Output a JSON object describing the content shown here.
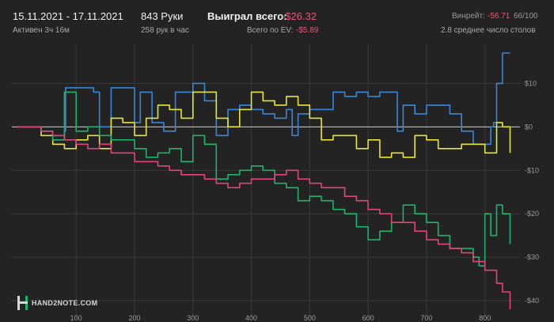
{
  "header": {
    "date_range": "15.11.2021 - 17.11.2021",
    "active": "Активен 3ч 16м",
    "hands": "843 Руки",
    "hands_per_hour": "258 рук в час",
    "won_label": "Выиграл всего:",
    "won_value": "-$26.32",
    "ev_label": "Всего по EV:",
    "ev_value": "-$5.89",
    "winrate_label": "Винрейт:",
    "winrate_value": "-56.71",
    "winrate_hands": "66/100",
    "avg_tables": "2.8 среднее число столов"
  },
  "logo": {
    "text": "HAND2NOTE.COM"
  },
  "chart_data": {
    "type": "line",
    "xlim": [
      -10,
      860
    ],
    "ylim": [
      -44,
      19
    ],
    "xticks": [
      100,
      200,
      300,
      400,
      500,
      600,
      700,
      800
    ],
    "yticks": [
      10,
      0,
      -10,
      -20,
      -30,
      -40
    ],
    "ytick_labels": [
      "$10",
      "$0",
      "-$10",
      "-$20",
      "-$30",
      "-$40"
    ],
    "grid": true,
    "colors": {
      "blue": "#3a86d8",
      "yellow": "#e6e63a",
      "green": "#1fb36b",
      "pink": "#e0457a",
      "zero": "#cfcfcf"
    },
    "series": [
      {
        "color": "#3a86d8",
        "x": [
          0,
          40,
          60,
          80,
          82,
          100,
          130,
          140,
          160,
          180,
          200,
          210,
          230,
          250,
          270,
          290,
          300,
          320,
          340,
          360,
          380,
          400,
          420,
          440,
          460,
          470,
          480,
          500,
          520,
          540,
          560,
          580,
          600,
          620,
          640,
          650,
          660,
          680,
          700,
          720,
          740,
          760,
          780,
          800,
          810,
          815,
          820,
          830,
          843
        ],
        "y": [
          0,
          -1,
          -2,
          -1,
          9,
          9,
          8,
          0,
          9,
          9,
          1,
          8,
          1,
          -1,
          8,
          8,
          10,
          6,
          -2,
          4,
          5,
          4,
          3,
          2,
          4,
          -2,
          3,
          4,
          4,
          8,
          7,
          8,
          7,
          8,
          8,
          -1,
          5,
          3,
          5,
          5,
          3,
          -1,
          -4,
          -4,
          0,
          1,
          10,
          17,
          17
        ]
      },
      {
        "color": "#e6e63a",
        "x": [
          0,
          40,
          60,
          80,
          100,
          120,
          140,
          160,
          180,
          200,
          220,
          240,
          260,
          280,
          300,
          320,
          340,
          360,
          380,
          400,
          420,
          440,
          460,
          480,
          500,
          520,
          540,
          560,
          580,
          600,
          620,
          640,
          660,
          680,
          700,
          720,
          740,
          760,
          780,
          800,
          820,
          830,
          843
        ],
        "y": [
          0,
          -2,
          -4,
          -5,
          -3,
          -2,
          -5,
          2,
          1,
          -2,
          2,
          5,
          4,
          2,
          8,
          8,
          2,
          0,
          4,
          8,
          6,
          5,
          7,
          5,
          2,
          -3,
          -2,
          -2,
          -5,
          -3,
          -7,
          -6,
          -7,
          -2,
          -3,
          -5,
          -5,
          -4,
          -4,
          -6,
          1,
          0,
          -6
        ]
      },
      {
        "color": "#1fb36b",
        "x": [
          0,
          40,
          60,
          80,
          100,
          120,
          140,
          160,
          180,
          200,
          220,
          240,
          260,
          280,
          300,
          320,
          340,
          360,
          380,
          400,
          420,
          440,
          460,
          480,
          500,
          520,
          540,
          560,
          580,
          600,
          620,
          640,
          660,
          680,
          700,
          720,
          740,
          760,
          780,
          790,
          800,
          810,
          820,
          830,
          843
        ],
        "y": [
          0,
          -1,
          -3,
          8,
          -1,
          0,
          -2,
          -3,
          -3,
          -5,
          -7,
          -6,
          -5,
          -8,
          -2,
          -4,
          -12,
          -11,
          -10,
          -9,
          -10,
          -13,
          -14,
          -17,
          -16,
          -17,
          -19,
          -20,
          -23,
          -26,
          -24,
          -22,
          -18,
          -20,
          -22,
          -25,
          -28,
          -28,
          -30,
          -32,
          -20,
          -25,
          -18,
          -20,
          -27
        ]
      },
      {
        "color": "#e0457a",
        "x": [
          0,
          40,
          60,
          80,
          100,
          120,
          140,
          160,
          180,
          200,
          220,
          240,
          260,
          280,
          300,
          320,
          340,
          360,
          380,
          400,
          420,
          440,
          460,
          480,
          500,
          520,
          540,
          560,
          580,
          600,
          620,
          640,
          660,
          680,
          700,
          720,
          740,
          760,
          780,
          800,
          820,
          830,
          843
        ],
        "y": [
          0,
          -1,
          -2,
          -3,
          -4,
          -5,
          -4,
          -6,
          -6,
          -8,
          -8,
          -9,
          -10,
          -11,
          -11,
          -12,
          -13,
          -14,
          -13,
          -12,
          -12,
          -11,
          -10,
          -12,
          -13,
          -14,
          -14,
          -16,
          -17,
          -19,
          -20,
          -22,
          -22,
          -24,
          -26,
          -27,
          -28,
          -29,
          -31,
          -33,
          -36,
          -38,
          -42
        ]
      }
    ]
  }
}
